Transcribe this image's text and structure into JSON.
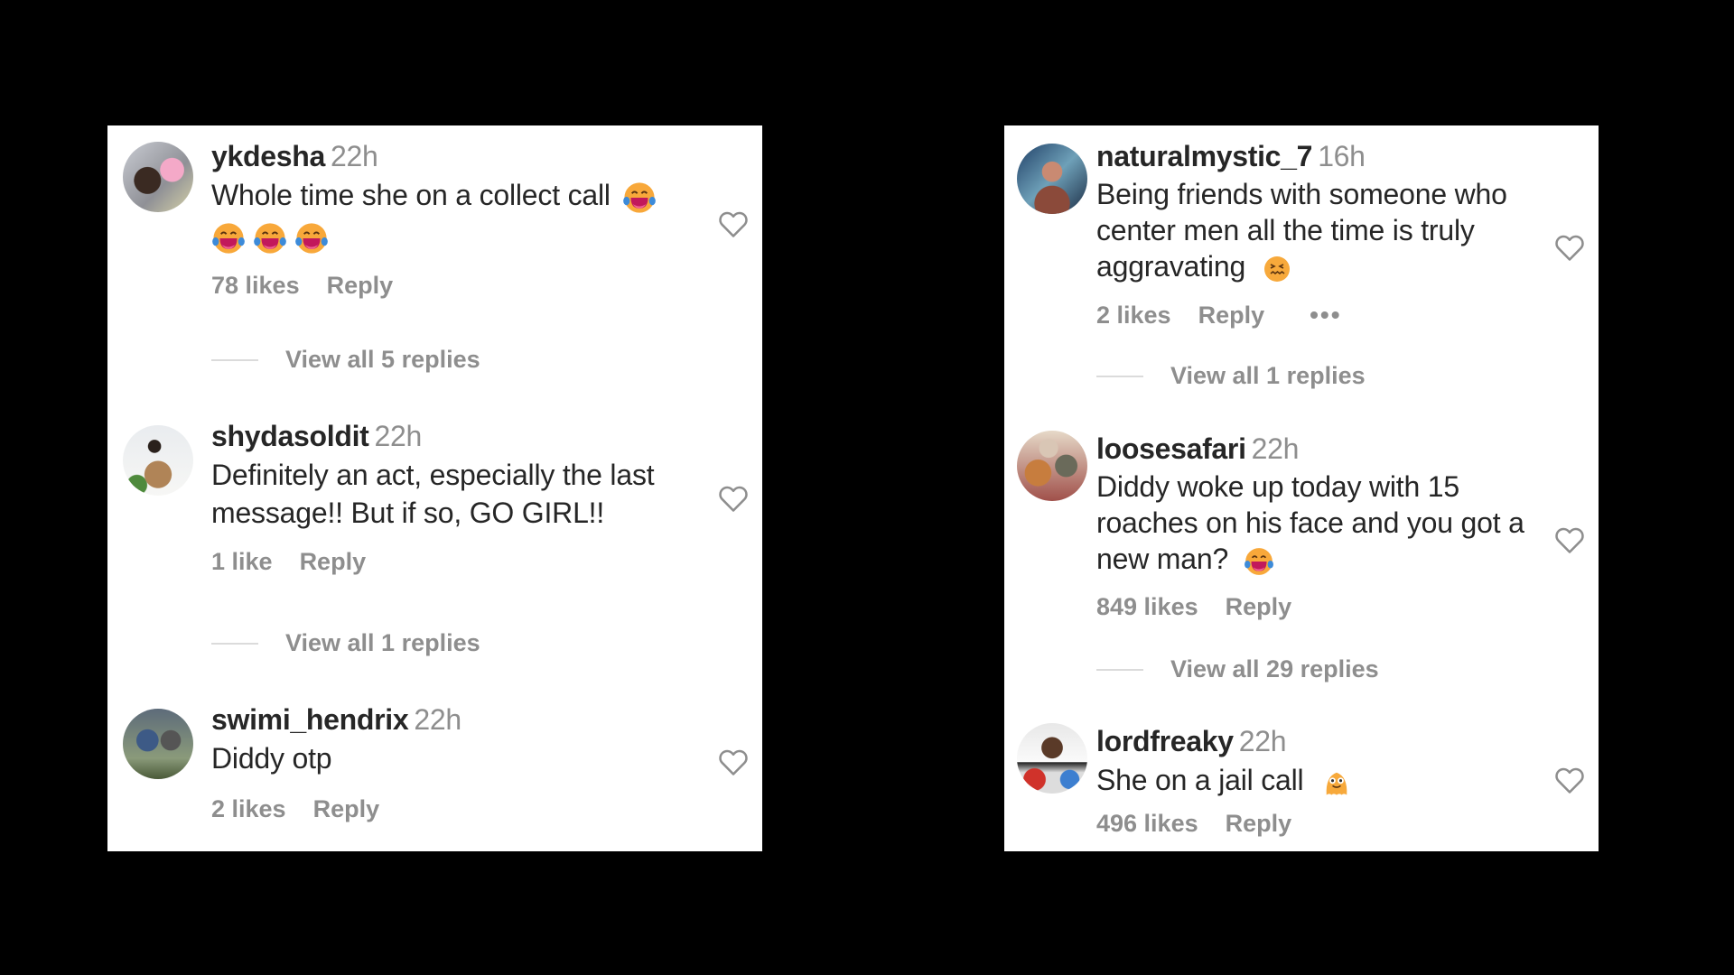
{
  "panels": [
    {
      "comments": [
        {
          "username": "ykdesha",
          "time": "22h",
          "text": "Whole time she on a collect call",
          "emoji": [
            "face-with-tears-of-joy",
            "face-with-tears-of-joy",
            "face-with-tears-of-joy",
            "face-with-tears-of-joy"
          ],
          "likes": "78 likes",
          "reply": "Reply",
          "view_replies": "View all 5 replies"
        },
        {
          "username": "shydasoldit",
          "time": "22h",
          "text_line1": "Definitely an act, especially the last",
          "text_line2": "message!! But if so, GO GIRL!!",
          "likes": "1 like",
          "reply": "Reply",
          "view_replies": "View all 1 replies"
        },
        {
          "username": "swimi_hendrix",
          "time": "22h",
          "text": "Diddy otp",
          "likes": "2 likes",
          "reply": "Reply"
        }
      ]
    },
    {
      "comments": [
        {
          "username": "naturalmystic_7",
          "time": "16h",
          "text_line1": "Being friends with someone who",
          "text_line2": "center men all the time is truly",
          "text_line3": "aggravating",
          "emoji": "confounded-face",
          "likes": "2 likes",
          "reply": "Reply",
          "more": "•••",
          "view_replies": "View all 1 replies"
        },
        {
          "username": "loosesafari",
          "time": "22h",
          "text_line1": "Diddy woke up today with 15",
          "text_line2": "roaches on his face and you got a",
          "text_line3": "new man?",
          "emoji": "face-with-tears-of-joy",
          "likes": "849 likes",
          "reply": "Reply",
          "view_replies": "View all 29 replies"
        },
        {
          "username": "lordfreaky",
          "time": "22h",
          "text": "She on a jail call",
          "emoji": "ghost-blob-smiley",
          "likes": "496 likes",
          "reply": "Reply"
        }
      ]
    }
  ],
  "colors": {
    "text": "#262626",
    "secondary": "#8e8e8e",
    "divider": "#dbdbdb",
    "emoji_yellow": "#f7a93b"
  }
}
